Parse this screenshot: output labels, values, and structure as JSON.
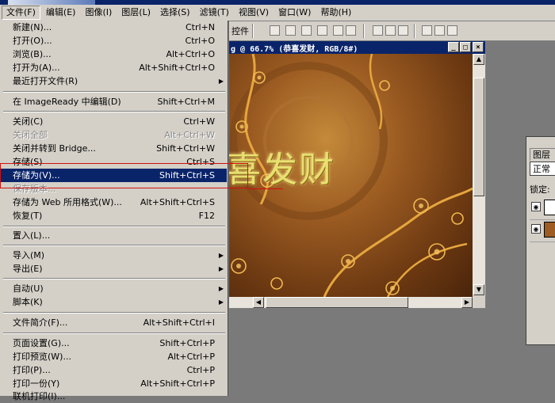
{
  "menubar": {
    "items": [
      "文件(F)",
      "编辑(E)",
      "图像(I)",
      "图层(L)",
      "选择(S)",
      "滤镜(T)",
      "视图(V)",
      "窗口(W)",
      "帮助(H)"
    ]
  },
  "toolbar": {
    "label": "控件"
  },
  "document": {
    "title": "g @ 66.7% (恭喜发财, RGB/8#)",
    "canvas_text": "喜发财",
    "minimize_label": "_",
    "maximize_label": "□",
    "close_label": "×"
  },
  "layers_panel": {
    "tab_label": "图层",
    "blend_mode": "正常",
    "lock_label": "锁定:"
  },
  "file_menu": {
    "items": [
      {
        "label": "新建(N)...",
        "shortcut": "Ctrl+N"
      },
      {
        "label": "打开(O)...",
        "shortcut": "Ctrl+O"
      },
      {
        "label": "浏览(B)...",
        "shortcut": "Alt+Ctrl+O"
      },
      {
        "label": "打开为(A)...",
        "shortcut": "Alt+Shift+Ctrl+O"
      },
      {
        "label": "最近打开文件(R)",
        "shortcut": "",
        "submenu": true
      },
      {
        "label": "在 ImageReady 中编辑(D)",
        "shortcut": "Shift+Ctrl+M"
      },
      {
        "label": "关闭(C)",
        "shortcut": "Ctrl+W"
      },
      {
        "label": "关闭全部",
        "shortcut": "Alt+Ctrl+W",
        "disabled": true
      },
      {
        "label": "关闭并转到 Bridge...",
        "shortcut": "Shift+Ctrl+W"
      },
      {
        "label": "存储(S)",
        "shortcut": "Ctrl+S"
      },
      {
        "label": "存储为(V)...",
        "shortcut": "Shift+Ctrl+S",
        "selected": true
      },
      {
        "label": "保存版本...",
        "shortcut": "",
        "disabled": true
      },
      {
        "label": "存储为 Web 所用格式(W)...",
        "shortcut": "Alt+Shift+Ctrl+S"
      },
      {
        "label": "恢复(T)",
        "shortcut": "F12"
      },
      {
        "label": "置入(L)...",
        "shortcut": ""
      },
      {
        "label": "导入(M)",
        "shortcut": "",
        "submenu": true
      },
      {
        "label": "导出(E)",
        "shortcut": "",
        "submenu": true
      },
      {
        "label": "自动(U)",
        "shortcut": "",
        "submenu": true
      },
      {
        "label": "脚本(K)",
        "shortcut": "",
        "submenu": true
      },
      {
        "label": "文件简介(F)...",
        "shortcut": "Alt+Shift+Ctrl+I"
      },
      {
        "label": "页面设置(G)...",
        "shortcut": "Shift+Ctrl+P"
      },
      {
        "label": "打印预览(W)...",
        "shortcut": "Alt+Ctrl+P"
      },
      {
        "label": "打印(P)...",
        "shortcut": "Ctrl+P"
      },
      {
        "label": "打印一份(Y)",
        "shortcut": "Alt+Shift+Ctrl+P"
      },
      {
        "label": "联机打印(I)...",
        "shortcut": ""
      }
    ]
  },
  "icons": {
    "submenu_arrow": "▶",
    "eye": "👁"
  },
  "colors": {
    "menu_bg": "#d4d0c8",
    "selection": "#0a246a",
    "annotation": "#d01010"
  }
}
